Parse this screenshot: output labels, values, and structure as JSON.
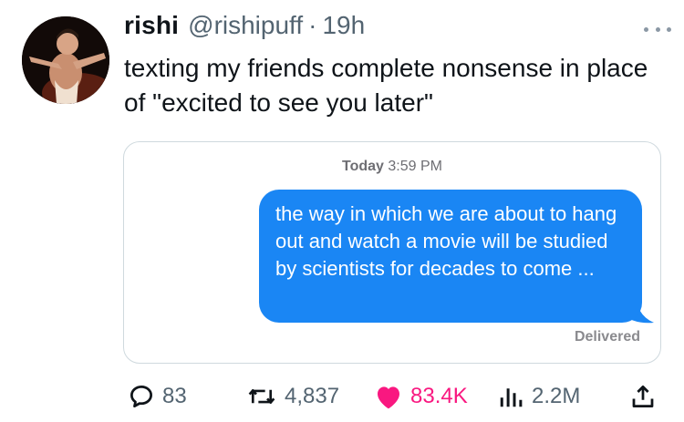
{
  "tweet": {
    "display_name": "rishi",
    "handle": "@rishipuff",
    "separator": "·",
    "time": "19h",
    "text": "texting my friends complete nonsense in place of \"excited to see you later\""
  },
  "media": {
    "timestamp_day": "Today",
    "timestamp_time": "3:59 PM",
    "message": "the way in which we are about to hang out and watch a movie will be studied by scientists for decades to come ...",
    "status": "Delivered",
    "bubble_color": "#1a86f4"
  },
  "actions": {
    "replies": "83",
    "retweets": "4,837",
    "likes": "83.4K",
    "views": "2.2M"
  },
  "icons": {
    "more": "more-horizontal-icon",
    "reply": "reply-icon",
    "retweet": "retweet-icon",
    "like": "heart-icon",
    "views": "views-icon",
    "share": "share-icon"
  },
  "colors": {
    "like": "#f91880",
    "muted": "#536471"
  }
}
